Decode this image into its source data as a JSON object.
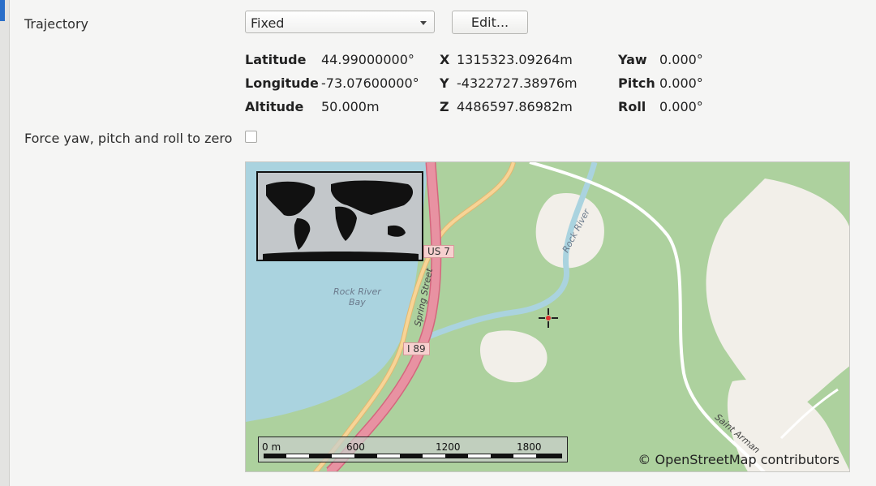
{
  "trajectory": {
    "label": "Trajectory",
    "selected": "Fixed",
    "edit_label": "Edit..."
  },
  "position": {
    "latitude_label": "Latitude",
    "latitude_value": "44.99000000°",
    "longitude_label": "Longitude",
    "longitude_value": "-73.07600000°",
    "altitude_label": "Altitude",
    "altitude_value": "50.000m"
  },
  "ecef": {
    "x_label": "X",
    "x_value": "1315323.09264m",
    "y_label": "Y",
    "y_value": "-4322727.38976m",
    "z_label": "Z",
    "z_value": "4486597.86982m"
  },
  "attitude": {
    "yaw_label": "Yaw",
    "yaw_value": "0.000°",
    "pitch_label": "Pitch",
    "pitch_value": "0.000°",
    "roll_label": "Roll",
    "roll_value": "0.000°"
  },
  "force_zero": {
    "label": "Force yaw, pitch and roll to zero",
    "checked": false
  },
  "map": {
    "place_labels": {
      "bay": "Rock River\nBay",
      "river": "Rock River",
      "street": "Spring Street",
      "road": "Saint Arman"
    },
    "road_shields": {
      "us7": "US 7",
      "i89": "I 89"
    },
    "scale_bar": {
      "ticks": [
        "0 m",
        "600",
        "1200",
        "1800"
      ]
    },
    "attribution": "© OpenStreetMap contributors",
    "colors": {
      "water": "#aad3df",
      "forest": "#add19e",
      "open": "#f2efe9",
      "motorway": "#e892a2",
      "trunk": "#f9b29c",
      "secondary": "#f7d496"
    }
  }
}
